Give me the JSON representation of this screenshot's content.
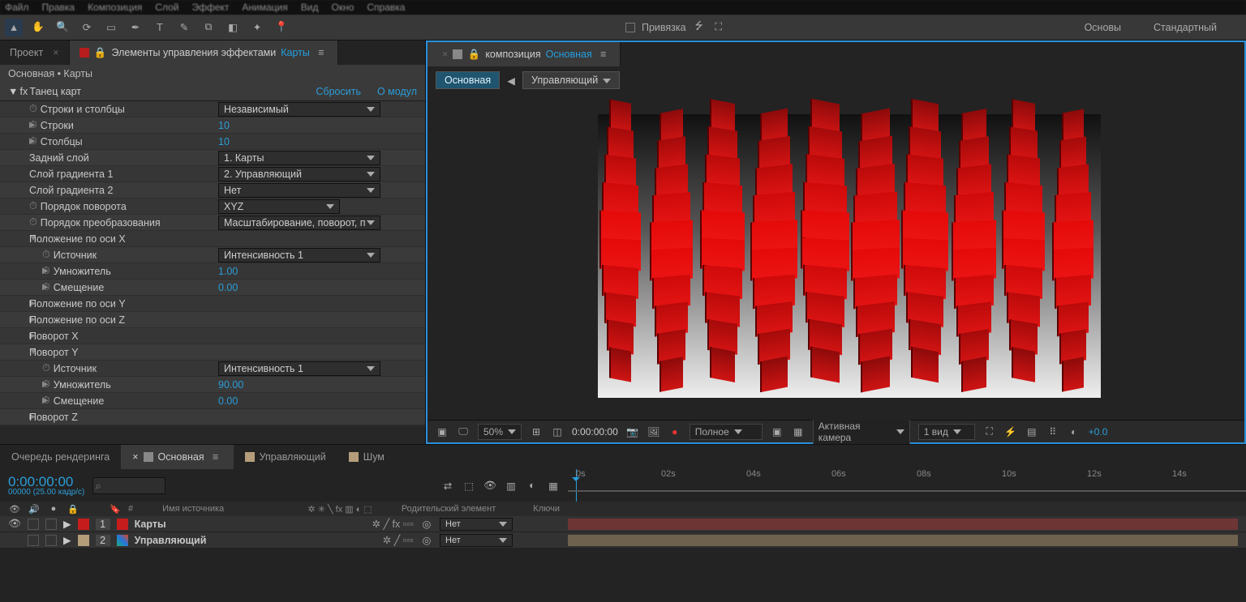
{
  "menu": [
    "Файл",
    "Правка",
    "Композиция",
    "Слой",
    "Эффект",
    "Анимация",
    "Вид",
    "Окно",
    "Справка"
  ],
  "snap_label": "Привязка",
  "workspaces": [
    "Основы",
    "Стандартный"
  ],
  "project_tab": "Проект",
  "ec_tab_prefix": "Элементы управления эффектами",
  "ec_tab_layer": "Карты",
  "breadcrumb": {
    "comp": "Основная",
    "layer": "Карты"
  },
  "fx": {
    "name": "Танец карт",
    "reset": "Сбросить",
    "about": "О модул",
    "rows_cols": "Строки и столбцы",
    "rows_cols_val": "Независимый",
    "rows": "Строки",
    "rows_val": "10",
    "cols": "Столбцы",
    "cols_val": "10",
    "back_layer": "Задний слой",
    "back_layer_val": "1. Карты",
    "grad1": "Слой градиента 1",
    "grad1_val": "2. Управляющий",
    "grad2": "Слой градиента 2",
    "grad2_val": "Нет",
    "rot_order": "Порядок поворота",
    "rot_order_val": "XYZ",
    "trans_order": "Порядок преобразования",
    "trans_order_val": "Масштабирование, поворот, п",
    "posx": "Положение по оси X",
    "src": "Источник",
    "src_val": "Интенсивность 1",
    "mult": "Умножитель",
    "mult_val": "1.00",
    "offs": "Смещение",
    "offs_val": "0.00",
    "posy": "Положение по оси Y",
    "posz": "Положение по оси Z",
    "rotx": "Поворот X",
    "roty": "Поворот Y",
    "roty_mult": "90.00",
    "roty_offs": "0.00",
    "rotz": "Поворот Z"
  },
  "comp_tab_prefix": "композиция",
  "comp_tab_name": "Основная",
  "flow": {
    "main": "Основная",
    "ctrl": "Управляющий"
  },
  "viewer": {
    "zoom": "50%",
    "time": "0:00:00:00",
    "res": "Полное",
    "cam": "Активная камера",
    "views": "1 вид",
    "exposure": "+0.0"
  },
  "bottom": {
    "render": "Очередь рендеринга",
    "main": "Основная",
    "ctrl": "Управляющий",
    "noise": "Шум",
    "timecode": "0:00:00:00",
    "fps": "00000 (25.00 кадр/с)",
    "col_src": "Имя источника",
    "col_parent": "Родительский элемент",
    "col_keys": "Ключи",
    "layer1": {
      "num": "1",
      "name": "Карты",
      "parent": "Нет"
    },
    "layer2": {
      "num": "2",
      "name": "Управляющий",
      "parent": "Нет"
    },
    "ticks": [
      "0s",
      "02s",
      "04s",
      "06s",
      "08s",
      "10s",
      "12s",
      "14s"
    ]
  }
}
